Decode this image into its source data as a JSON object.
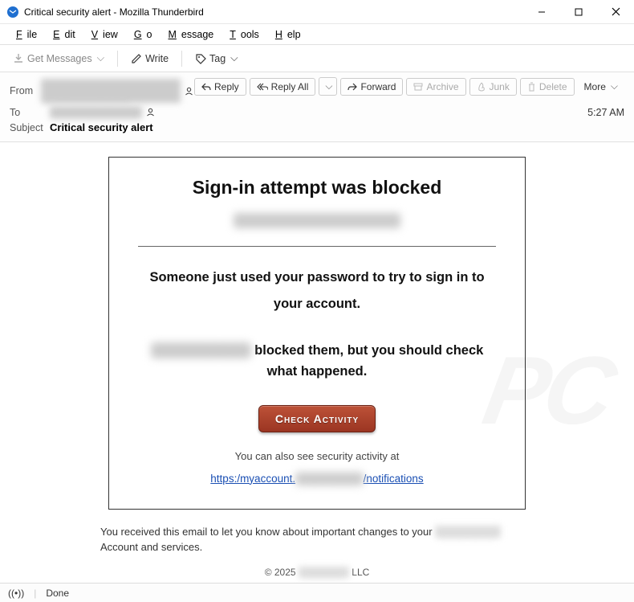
{
  "window": {
    "title": "Critical security alert - Mozilla Thunderbird"
  },
  "menubar": [
    "File",
    "Edit",
    "View",
    "Go",
    "Message",
    "Tools",
    "Help"
  ],
  "toolbar": {
    "get_messages": "Get Messages",
    "write": "Write",
    "tag": "Tag"
  },
  "actions": {
    "reply": "Reply",
    "reply_all": "Reply All",
    "forward": "Forward",
    "archive": "Archive",
    "junk": "Junk",
    "delete": "Delete",
    "more": "More"
  },
  "headers": {
    "from_label": "From",
    "from_value": "████████ ███ ████████████",
    "to_label": "To",
    "to_value": "████████████",
    "subject_label": "Subject",
    "subject_value": "Critical security alert",
    "time": "5:27 AM"
  },
  "body": {
    "title": "Sign-in attempt was blocked",
    "redacted_email": "██████████████",
    "msg1": "Someone just used your password to try to sign in to your account.",
    "msg2_redacted": "██████████",
    "msg2_rest": " blocked them, but you should check what happened.",
    "button": "Check Activity",
    "sub": "You can also see security activity at",
    "link_pre": "https:/myaccount.",
    "link_redacted": "████████",
    "link_post": "/notifications"
  },
  "footer": {
    "text_pre": "You received this email to let you know about important changes to your ",
    "text_redacted": "████████",
    "text_post": " Account and services.",
    "copyright_pre": "© 2025 ",
    "copyright_redacted": "██████",
    "copyright_post": " LLC"
  },
  "status": {
    "text": "Done"
  }
}
